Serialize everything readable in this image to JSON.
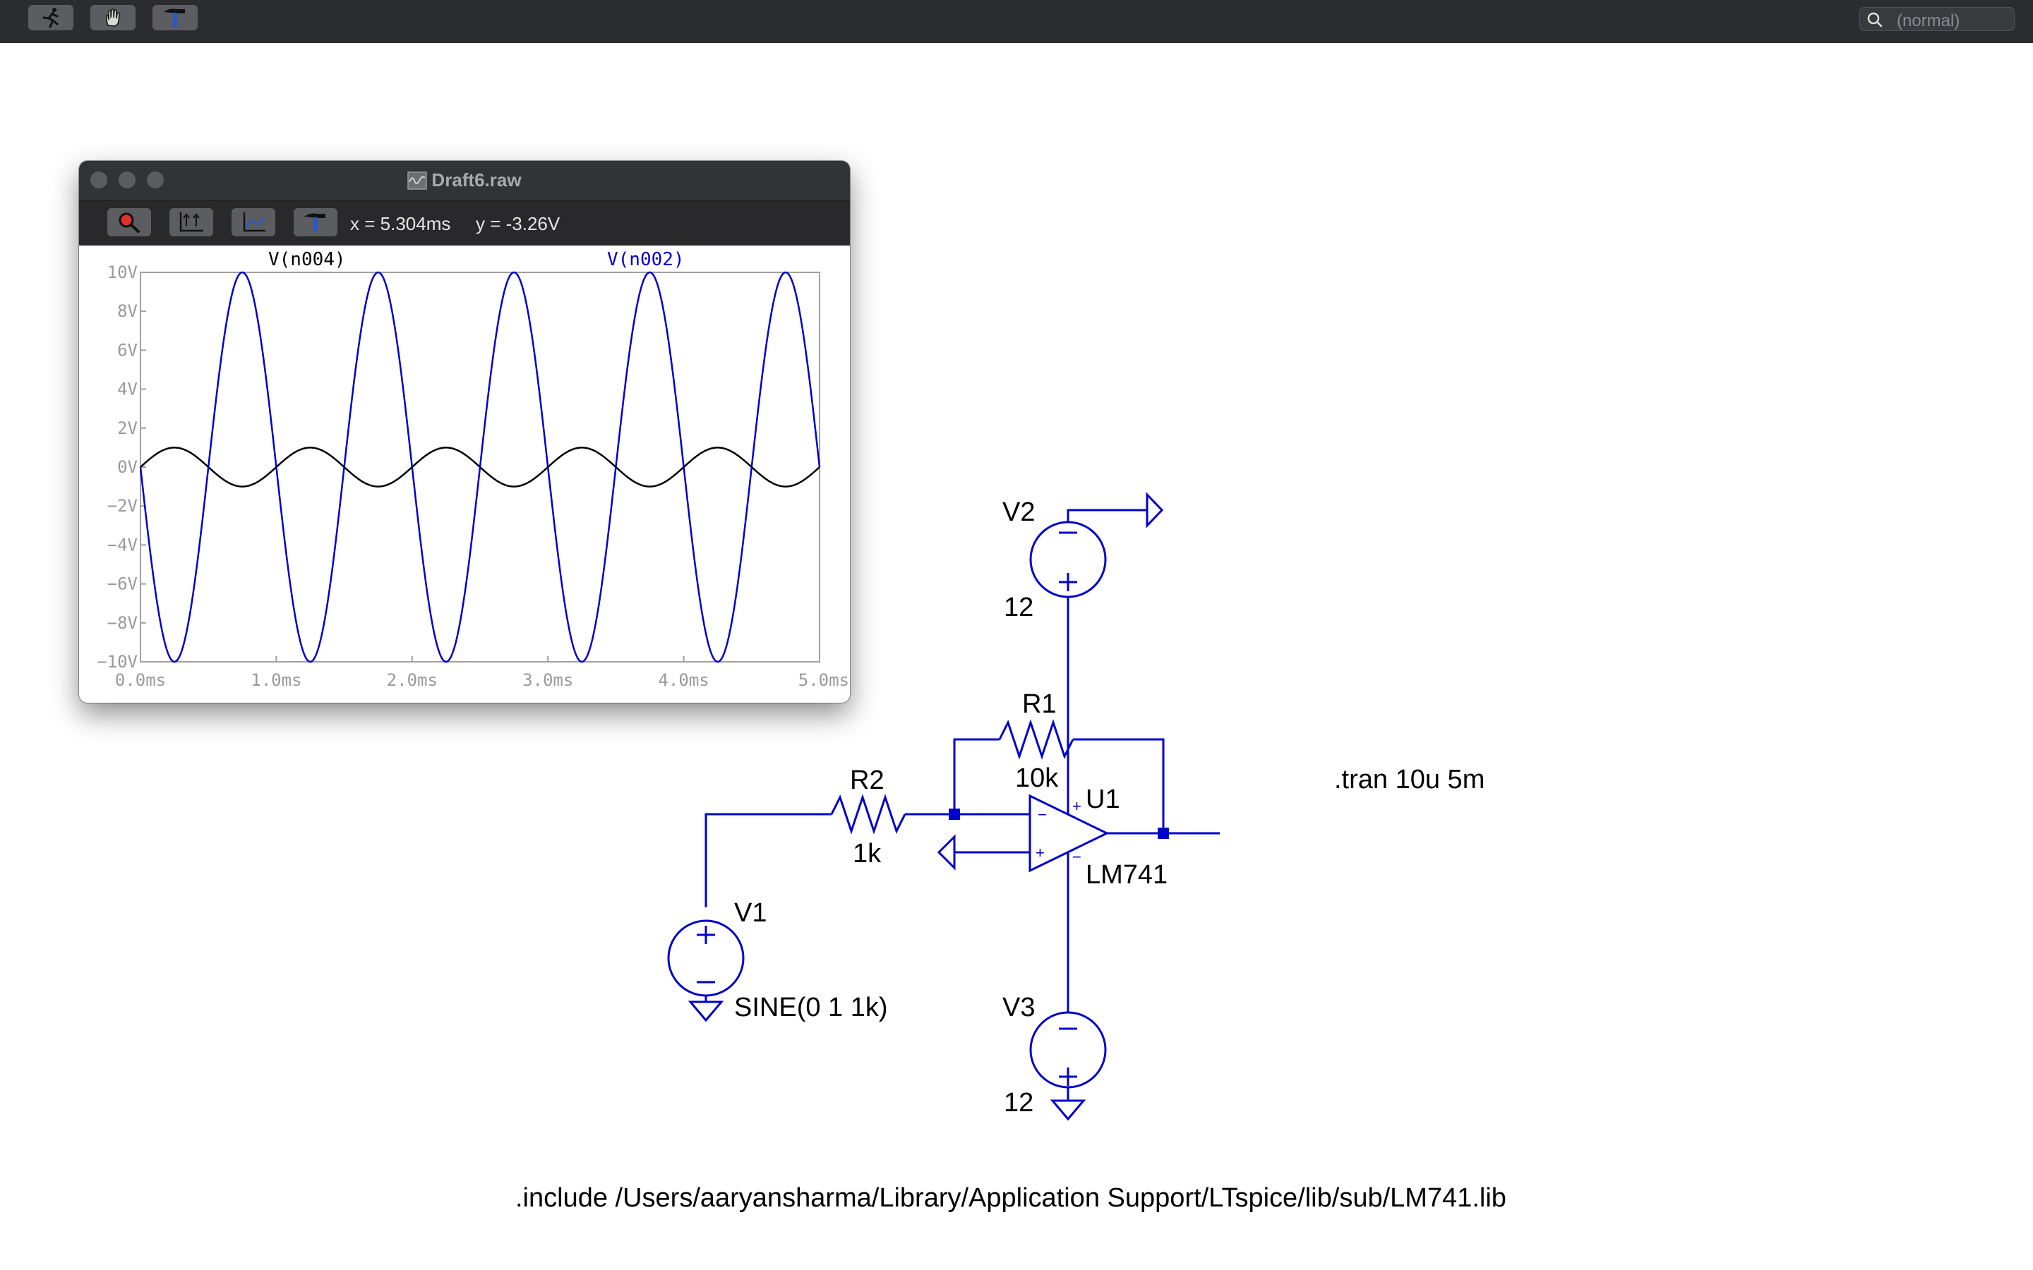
{
  "toolbar": {
    "buttons": [
      {
        "name": "run-button",
        "icon": "running-man-icon"
      },
      {
        "name": "halt-button",
        "icon": "hand-icon"
      },
      {
        "name": "hammer-button",
        "icon": "hammer-icon"
      }
    ],
    "search_placeholder": "(normal)"
  },
  "waveform_window": {
    "title": "Draft6.raw",
    "readout_x": "x = 5.304ms",
    "readout_y": "y = -3.26V",
    "buttons": [
      "zoom-icon",
      "autorange-icon",
      "axis-icon",
      "hammer-icon"
    ]
  },
  "chart_data": {
    "type": "line",
    "xlim": [
      0,
      5
    ],
    "ylim": [
      -10,
      10
    ],
    "x_ticks": [
      "0.0ms",
      "1.0ms",
      "2.0ms",
      "3.0ms",
      "4.0ms",
      "5.0ms"
    ],
    "y_ticks": [
      "10V",
      "8V",
      "6V",
      "4V",
      "2V",
      "0V",
      "-2V",
      "-4V",
      "-6V",
      "-8V",
      "-10V"
    ],
    "grid": false,
    "series": [
      {
        "name": "V(n004)",
        "color": "#000000",
        "amplitude": 1,
        "frequency_khz": 1,
        "phase": "non-inverted"
      },
      {
        "name": "V(n002)",
        "color": "#0000cc",
        "amplitude": 10,
        "frequency_khz": 1,
        "phase": "inverted"
      }
    ]
  },
  "schematic": {
    "wire_color": "#0000cc",
    "v1": {
      "ref": "V1",
      "value": "SINE(0 1 1k)"
    },
    "v2": {
      "ref": "V2",
      "value": "12"
    },
    "v3": {
      "ref": "V3",
      "value": "12"
    },
    "r1": {
      "ref": "R1",
      "value": "10k"
    },
    "r2": {
      "ref": "R2",
      "value": "1k"
    },
    "u1": {
      "ref": "U1",
      "value": "LM741"
    },
    "tran_directive": ".tran 10u 5m",
    "include_directive": ".include /Users/aaryansharma/Library/Application Support/LTspice/lib/sub/LM741.lib"
  }
}
